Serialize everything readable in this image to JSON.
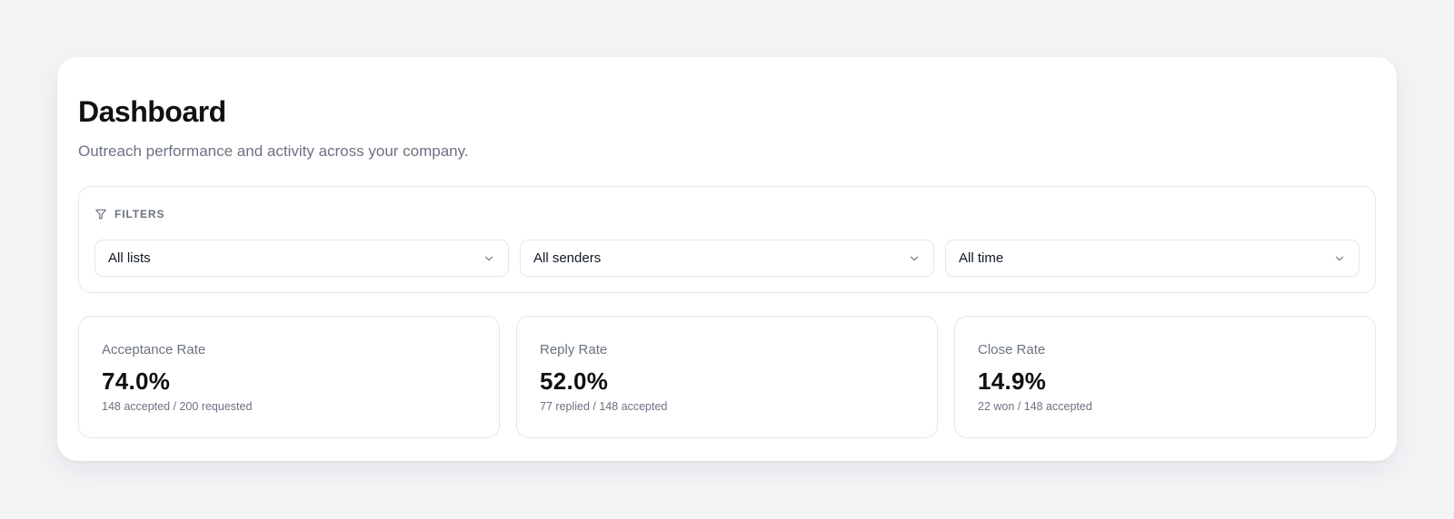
{
  "header": {
    "title": "Dashboard",
    "subtitle": "Outreach performance and activity across your company."
  },
  "filters": {
    "label": "FILTERS",
    "icon": "filter-icon",
    "list_select": {
      "value": "All lists"
    },
    "sender_select": {
      "value": "All senders"
    },
    "time_select": {
      "value": "All time"
    }
  },
  "metrics": [
    {
      "label": "Acceptance Rate",
      "value": "74.0%",
      "detail": "148 accepted / 200 requested"
    },
    {
      "label": "Reply Rate",
      "value": "52.0%",
      "detail": "77 replied / 148 accepted"
    },
    {
      "label": "Close Rate",
      "value": "14.9%",
      "detail": "22 won / 148 accepted"
    }
  ],
  "colors": {
    "background": "#f3f4f6",
    "card": "#ffffff",
    "border": "#e5e7eb",
    "muted_text": "#6b7280",
    "primary_text": "#111111"
  }
}
